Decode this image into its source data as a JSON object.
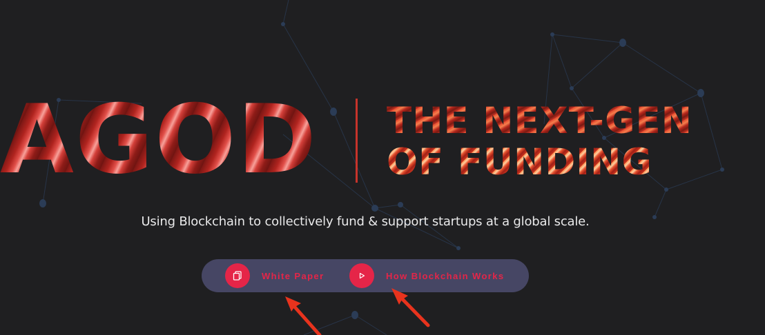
{
  "hero": {
    "brand": "AGOD",
    "tagline_line1": "THE NEXT-GEN",
    "tagline_line2": "OF FUNDING",
    "subtitle": "Using Blockchain to collectively fund & support startups at a global scale."
  },
  "cta": {
    "white_paper": {
      "label": "White Paper",
      "icon": "document-copy-icon"
    },
    "how_blockchain": {
      "label": "How Blockchain Works",
      "icon": "play-icon"
    }
  },
  "colors": {
    "background": "#1f1f21",
    "accent": "#e52548",
    "brand_red": "#c5332c",
    "cta_bar": "#464664",
    "annotation_arrow": "#e8331d"
  }
}
